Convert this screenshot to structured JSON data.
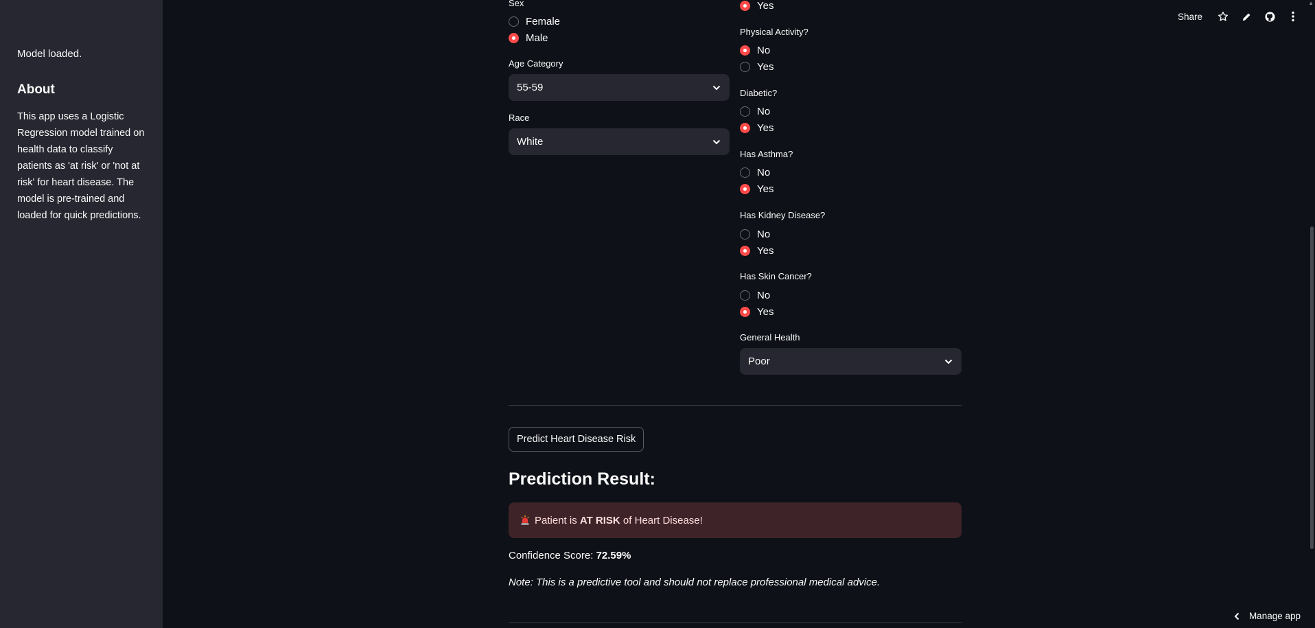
{
  "sidebar": {
    "status": "Model loaded.",
    "about_title": "About",
    "about_text": "This app uses a Logistic Regression model trained on health data to classify patients as 'at risk' or 'not at risk' for heart disease. The model is pre-trained and loaded for quick predictions."
  },
  "toolbar": {
    "share_label": "Share",
    "icons": [
      "star-icon",
      "edit-icon",
      "github-icon",
      "more-vertical-icon"
    ]
  },
  "form": {
    "sex": {
      "label": "Sex",
      "options": [
        "Female",
        "Male"
      ],
      "selected": "Male"
    },
    "age": {
      "label": "Age Category",
      "value": "55-59"
    },
    "race": {
      "label": "Race",
      "value": "White"
    },
    "prev_yes": "Yes",
    "physical": {
      "label": "Physical Activity?",
      "no": "No",
      "yes": "Yes",
      "selected": "No"
    },
    "diabetic": {
      "label": "Diabetic?",
      "no": "No",
      "yes": "Yes",
      "selected": "Yes"
    },
    "asthma": {
      "label": "Has Asthma?",
      "no": "No",
      "yes": "Yes",
      "selected": "Yes"
    },
    "kidney": {
      "label": "Has Kidney Disease?",
      "no": "No",
      "yes": "Yes",
      "selected": "Yes"
    },
    "skin": {
      "label": "Has Skin Cancer?",
      "no": "No",
      "yes": "Yes",
      "selected": "Yes"
    },
    "general": {
      "label": "General Health",
      "value": "Poor"
    }
  },
  "predict_button": "Predict Heart Disease Risk",
  "result": {
    "heading": "Prediction Result:",
    "alert_prefix": "Patient is ",
    "alert_strong": "AT RISK",
    "alert_suffix": " of Heart Disease!",
    "confidence_label": "Confidence Score: ",
    "confidence_value": "72.59%",
    "note": "Note: This is a predictive tool and should not replace professional medical advice."
  },
  "manage_app": "Manage app",
  "colors": {
    "accent": "#ff4b4b",
    "background": "#0e1117",
    "sidebar": "#262730",
    "alert_bg": "#3e2328"
  }
}
